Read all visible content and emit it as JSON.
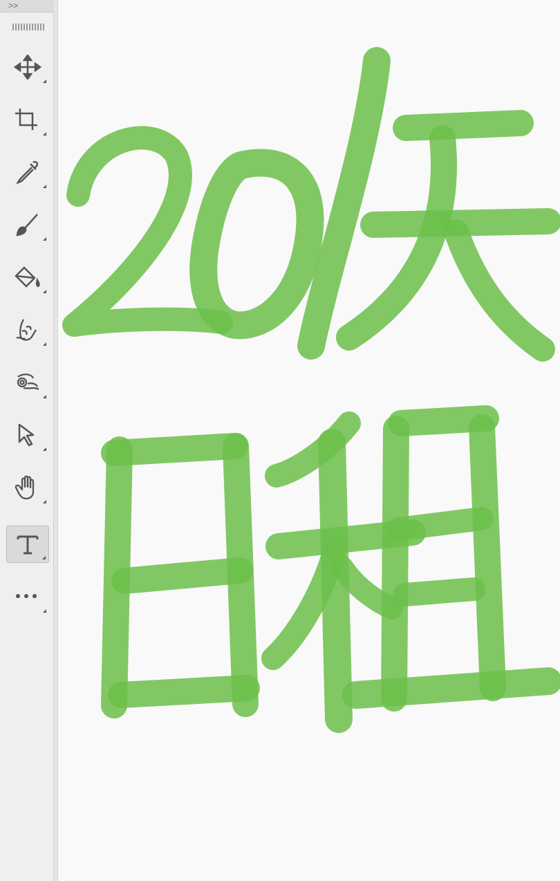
{
  "toolbar": {
    "collapse_label": ">>",
    "tools": [
      {
        "icon": "move-icon",
        "name": "move-tool"
      },
      {
        "icon": "crop-icon",
        "name": "crop-tool"
      },
      {
        "icon": "eyedropper-icon",
        "name": "eyedropper-tool"
      },
      {
        "icon": "brush-icon",
        "name": "brush-tool"
      },
      {
        "icon": "paint-bucket-icon",
        "name": "paint-bucket-tool"
      },
      {
        "icon": "smudge-finger-icon",
        "name": "smudge-tool"
      },
      {
        "icon": "liquify-icon",
        "name": "liquify-tool"
      },
      {
        "icon": "select-arrow-icon",
        "name": "selection-tool"
      },
      {
        "icon": "hand-icon",
        "name": "hand-tool"
      },
      {
        "icon": "text-icon",
        "name": "text-tool",
        "active": true
      },
      {
        "icon": "more-icon",
        "name": "more-tools"
      }
    ]
  },
  "canvas": {
    "ink_color": "#6cc04a",
    "handwriting": [
      "20",
      "/",
      "庆",
      "日",
      "租"
    ]
  }
}
